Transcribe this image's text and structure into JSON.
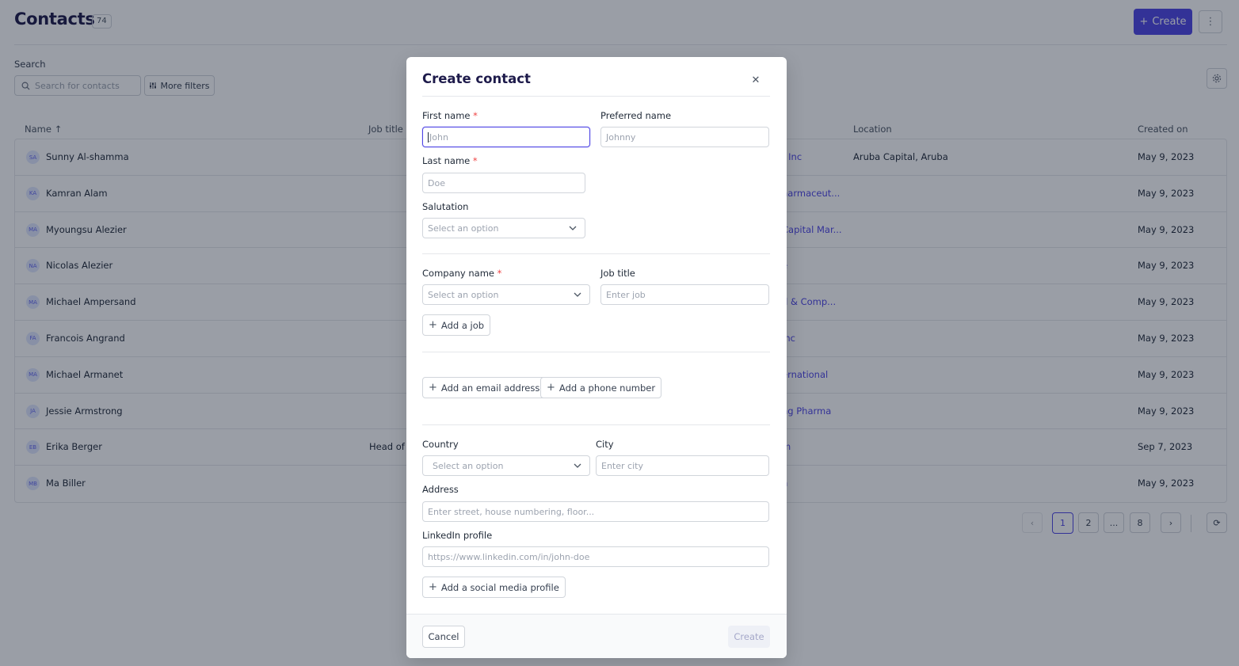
{
  "page": {
    "title": "Contacts",
    "count": "74",
    "create_label": "Create",
    "search_label": "Search",
    "search_placeholder": "Search for contacts",
    "filters_label": "More filters"
  },
  "table": {
    "headers": {
      "name": "Name",
      "job": "Job title",
      "location": "Location",
      "created": "Created on"
    },
    "rows": [
      {
        "initials": "SA",
        "name": "Sunny Al-shamma",
        "job": "",
        "company": "t Inc",
        "location": "Aruba Capital, Aruba",
        "created": "May 9, 2023"
      },
      {
        "initials": "KA",
        "name": "Kamran Alam",
        "job": "",
        "company": "harmaceut...",
        "location": "",
        "created": "May 9, 2023"
      },
      {
        "initials": "MA",
        "name": "Myoungsu Alezier",
        "job": "",
        "company": "Capital Mar...",
        "location": "",
        "created": "May 9, 2023"
      },
      {
        "initials": "NA",
        "name": "Nicolas Alezier",
        "job": "",
        "company": "e",
        "location": "",
        "created": "May 9, 2023"
      },
      {
        "initials": "MA",
        "name": "Michael Ampersand",
        "job": "",
        "company": "d & Comp...",
        "location": "",
        "created": "May 9, 2023"
      },
      {
        "initials": "FA",
        "name": "Francois Angrand",
        "job": "",
        "company": "Inc",
        "location": "",
        "created": "May 9, 2023"
      },
      {
        "initials": "MA",
        "name": "Michael Armanet",
        "job": "",
        "company": "ernational",
        "location": "",
        "created": "May 9, 2023"
      },
      {
        "initials": "JA",
        "name": "Jessie Armstrong",
        "job": "",
        "company": "ng Pharma",
        "location": "",
        "created": "May 9, 2023"
      },
      {
        "initials": "EB",
        "name": "Erika Berger",
        "job": "Head of E",
        "company": "m",
        "location": "",
        "created": "Sep 7, 2023"
      },
      {
        "initials": "MB",
        "name": "Ma Biller",
        "job": "",
        "company": "n",
        "location": "",
        "created": "May 9, 2023"
      }
    ]
  },
  "pagination": {
    "pages": [
      "1",
      "2",
      "...",
      "8"
    ],
    "current": "1"
  },
  "modal": {
    "title": "Create contact",
    "first_name": {
      "label": "First name",
      "placeholder": "John",
      "required": "*"
    },
    "preferred_name": {
      "label": "Preferred name",
      "placeholder": "Johnny"
    },
    "last_name": {
      "label": "Last name",
      "placeholder": "Doe",
      "required": "*"
    },
    "salutation": {
      "label": "Salutation",
      "placeholder": "Select an option"
    },
    "company_name": {
      "label": "Company name",
      "placeholder": "Select an option",
      "required": "*"
    },
    "job_title": {
      "label": "Job title",
      "placeholder": "Enter job"
    },
    "add_job": "Add a job",
    "add_email": "Add an email address",
    "add_phone": "Add a phone number",
    "country": {
      "label": "Country",
      "placeholder": "Select an option"
    },
    "city": {
      "label": "City",
      "placeholder": "Enter city"
    },
    "address": {
      "label": "Address",
      "placeholder": "Enter street, house numbering, floor..."
    },
    "linkedin": {
      "label": "LinkedIn profile",
      "placeholder": "https://www.linkedin.com/in/john-doe"
    },
    "add_social": "Add a social media profile",
    "cancel_label": "Cancel",
    "create_label": "Create"
  },
  "colors": {
    "accent": "#4f46e5",
    "required": "#ef4444",
    "overlay": "rgba(15,23,42,0.42)"
  }
}
